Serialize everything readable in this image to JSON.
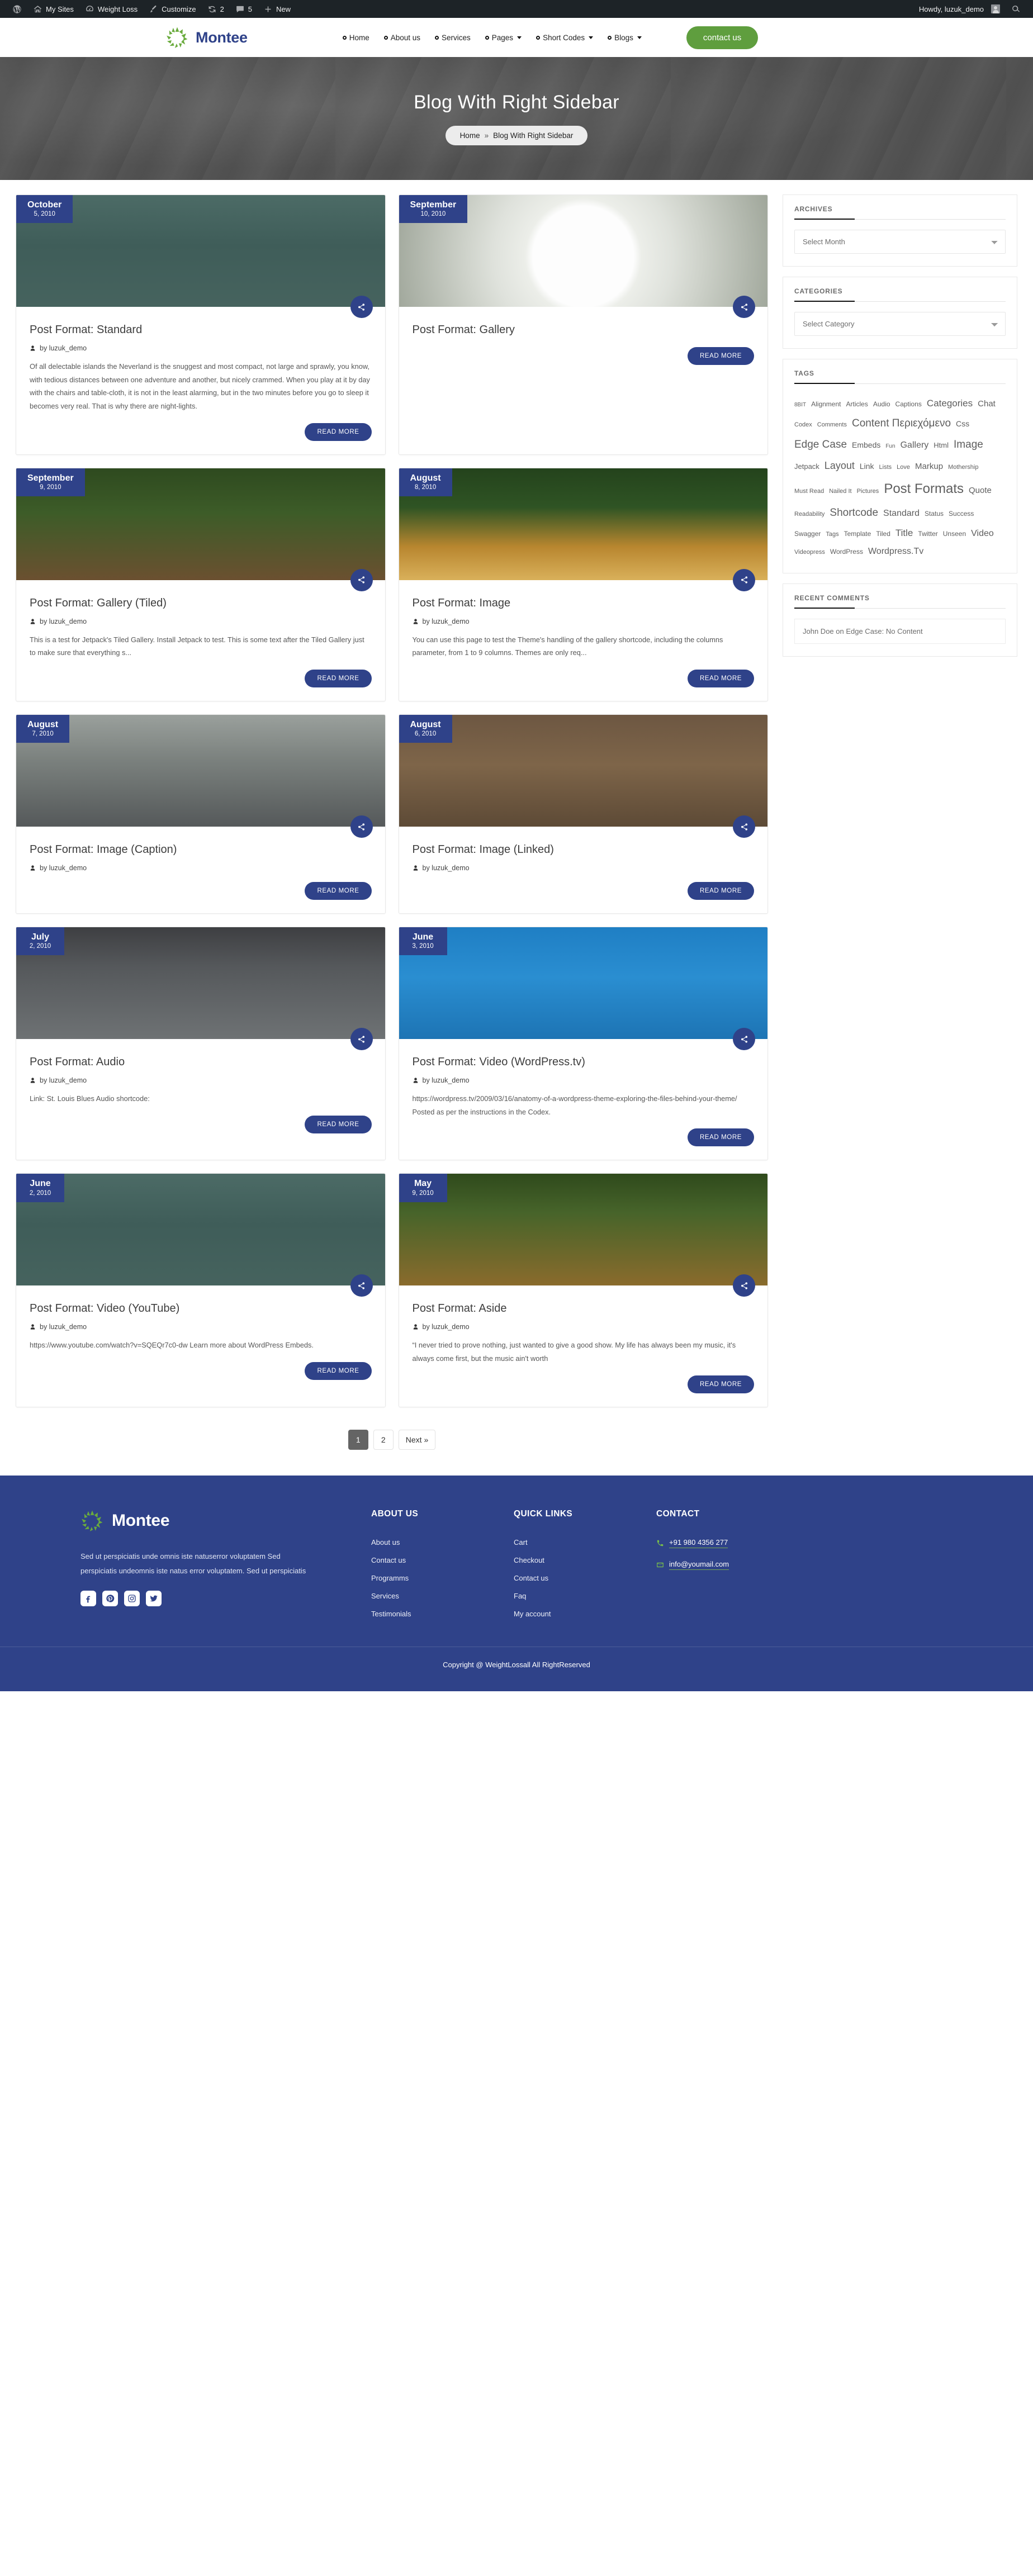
{
  "adminbar": {
    "items": [
      {
        "icon": "wordpress-icon",
        "label": ""
      },
      {
        "icon": "sites-icon",
        "label": "My Sites"
      },
      {
        "icon": "dashboard-icon",
        "label": "Weight Loss"
      },
      {
        "icon": "brush-icon",
        "label": "Customize"
      },
      {
        "icon": "updates-icon",
        "label": "2"
      },
      {
        "icon": "comments-icon",
        "label": "5"
      },
      {
        "icon": "plus-icon",
        "label": "New"
      }
    ],
    "howdy": "Howdy, luzuk_demo",
    "search_icon": "search-icon"
  },
  "header": {
    "brand": "Montee",
    "nav": [
      {
        "label": "Home",
        "has_caret": false
      },
      {
        "label": "About us",
        "has_caret": false
      },
      {
        "label": "Services",
        "has_caret": false
      },
      {
        "label": "Pages",
        "has_caret": true
      },
      {
        "label": "Short Codes",
        "has_caret": true
      },
      {
        "label": "Blogs",
        "has_caret": true
      }
    ],
    "cta": "contact us",
    "cta_color": "#5f9e3e"
  },
  "banner": {
    "title": "Blog With Right Sidebar",
    "crumb_home": "Home",
    "crumb_sep": "»",
    "crumb_current": "Blog With Right Sidebar"
  },
  "posts": [
    {
      "month": "October",
      "day": "5, 2010",
      "title": "Post Format: Standard",
      "author": "by luzuk_demo",
      "excerpt": "Of all delectable islands the Neverland is the snuggest and most compact, not large and sprawly, you know, with tedious distances between one adventure and another, but nicely crammed. When you play at it by day with the chairs and table-cloth, it is not in the least alarming, but in the two minutes before you go to sleep it becomes very real. That is why there are night-lights.",
      "read_more": "READ MORE",
      "image": "sandwich-with-caliper"
    },
    {
      "month": "September",
      "day": "10, 2010",
      "title": "Post Format: Gallery",
      "author": "",
      "excerpt": "",
      "read_more": "READ MORE",
      "image": "broccoli-on-white-plate"
    },
    {
      "month": "September",
      "day": "9, 2010",
      "title": "Post Format: Gallery (Tiled)",
      "author": "by luzuk_demo",
      "excerpt": "This is a test for Jetpack's Tiled Gallery. Install Jetpack to test. This is some text after the Tiled Gallery just to make sure that everything s...",
      "read_more": "READ MORE",
      "image": "burger-and-drinks"
    },
    {
      "month": "August",
      "day": "8, 2010",
      "title": "Post Format: Image",
      "author": "by luzuk_demo",
      "excerpt": "You can use this page to test the Theme's handling of the gallery shortcode, including the columns parameter, from 1 to 9 columns. Themes are only req...",
      "read_more": "READ MORE",
      "image": "smoothies-and-fruit"
    },
    {
      "month": "August",
      "day": "7, 2010",
      "title": "Post Format: Image (Caption)",
      "author": "by luzuk_demo",
      "excerpt": "",
      "read_more": "READ MORE",
      "image": "grilled-vegetables-plate"
    },
    {
      "month": "August",
      "day": "6, 2010",
      "title": "Post Format: Image (Linked)",
      "author": "by luzuk_demo",
      "excerpt": "",
      "read_more": "READ MORE",
      "image": "salad-bowl-on-table"
    },
    {
      "month": "July",
      "day": "2, 2010",
      "title": "Post Format: Audio",
      "author": "by luzuk_demo",
      "excerpt": "Link: St. Louis Blues Audio shortcode:",
      "read_more": "READ MORE",
      "image": "vegetables-with-caliper"
    },
    {
      "month": "June",
      "day": "3, 2010",
      "title": "Post Format: Video (WordPress.tv)",
      "author": "by luzuk_demo",
      "excerpt": "https://wordpress.tv/2009/03/16/anatomy-of-a-wordpress-theme-exploring-the-files-behind-your-theme/ Posted as per the instructions in the Codex.",
      "read_more": "READ MORE",
      "image": "sandwich-with-tape-measure"
    },
    {
      "month": "June",
      "day": "2, 2010",
      "title": "Post Format: Video (YouTube)",
      "author": "by luzuk_demo",
      "excerpt": "https://www.youtube.com/watch?v=SQEQr7c0-dw Learn more about WordPress Embeds.",
      "read_more": "READ MORE",
      "image": "sandwich-with-caliper-2"
    },
    {
      "month": "May",
      "day": "9, 2010",
      "title": "Post Format: Aside",
      "author": "by luzuk_demo",
      "excerpt": "“I never tried to prove nothing, just wanted to give a good show. My life has always been my music, it's always come first, but the music ain't worth",
      "read_more": "READ MORE",
      "image": "banana-and-jars"
    }
  ],
  "sidebar": {
    "archives": {
      "title": "ARCHIVES",
      "select_value": "Select Month"
    },
    "categories": {
      "title": "CATEGORIES",
      "select_value": "Select Category"
    },
    "tags": {
      "title": "TAGS",
      "items": [
        {
          "label": "8BIT",
          "size": 10
        },
        {
          "label": "Alignment",
          "size": 12
        },
        {
          "label": "Articles",
          "size": 12
        },
        {
          "label": "Audio",
          "size": 12
        },
        {
          "label": "Captions",
          "size": 12
        },
        {
          "label": "Categories",
          "size": 17
        },
        {
          "label": "Chat",
          "size": 15
        },
        {
          "label": "Codex",
          "size": 11
        },
        {
          "label": "Comments",
          "size": 11
        },
        {
          "label": "Content Περιεχόμενο",
          "size": 19
        },
        {
          "label": "Css",
          "size": 14
        },
        {
          "label": "Edge Case",
          "size": 19
        },
        {
          "label": "Embeds",
          "size": 14
        },
        {
          "label": "Fun",
          "size": 10
        },
        {
          "label": "Gallery",
          "size": 16
        },
        {
          "label": "Html",
          "size": 13
        },
        {
          "label": "Image",
          "size": 19
        },
        {
          "label": "Jetpack",
          "size": 13
        },
        {
          "label": "Layout",
          "size": 18
        },
        {
          "label": "Link",
          "size": 14
        },
        {
          "label": "Lists",
          "size": 11
        },
        {
          "label": "Love",
          "size": 11
        },
        {
          "label": "Markup",
          "size": 15
        },
        {
          "label": "Mothership",
          "size": 11
        },
        {
          "label": "Must Read",
          "size": 11
        },
        {
          "label": "Nailed It",
          "size": 11
        },
        {
          "label": "Pictures",
          "size": 11
        },
        {
          "label": "Post Formats",
          "size": 24
        },
        {
          "label": "Quote",
          "size": 15
        },
        {
          "label": "Readability",
          "size": 11
        },
        {
          "label": "Shortcode",
          "size": 19
        },
        {
          "label": "Standard",
          "size": 16
        },
        {
          "label": "Status",
          "size": 12
        },
        {
          "label": "Success",
          "size": 12
        },
        {
          "label": "Swagger",
          "size": 12
        },
        {
          "label": "Tags",
          "size": 11
        },
        {
          "label": "Template",
          "size": 12
        },
        {
          "label": "Tiled",
          "size": 12
        },
        {
          "label": "Title",
          "size": 17
        },
        {
          "label": "Twitter",
          "size": 12
        },
        {
          "label": "Unseen",
          "size": 12
        },
        {
          "label": "Video",
          "size": 16
        },
        {
          "label": "Videopress",
          "size": 11
        },
        {
          "label": "WordPress",
          "size": 12
        },
        {
          "label": "Wordpress.Tv",
          "size": 16
        }
      ]
    },
    "recent_comments": {
      "title": "RECENT COMMENTS",
      "items": [
        "John Doe on Edge Case: No Content"
      ]
    }
  },
  "pagination": {
    "pages": [
      "1",
      "2"
    ],
    "next": "Next »",
    "current": "1"
  },
  "footer": {
    "brand": "Montee",
    "about_text": "Sed ut perspiciatis unde omnis iste natuserror voluptatem Sed perspiciatis undeomnis iste natus error voluptatem. Sed ut perspiciatis",
    "socials": [
      "facebook-icon",
      "pinterest-icon",
      "instagram-icon",
      "twitter-icon"
    ],
    "columns": [
      {
        "head": "ABOUT US",
        "links": [
          "About us",
          "Contact us",
          "Programms",
          "Services",
          "Testimonials"
        ]
      },
      {
        "head": "QUICK LINKS",
        "links": [
          "Cart",
          "Checkout",
          "Contact us",
          "Faq",
          "My account"
        ]
      }
    ],
    "contact": {
      "head": "CONTACT",
      "phone": "+91 980 4356 277",
      "email": "info@youmail.com"
    },
    "copyright": "Copyright @ WeightLossall All RightReserved",
    "bg_color": "#2f4289",
    "accent_color": "#79c04a"
  }
}
